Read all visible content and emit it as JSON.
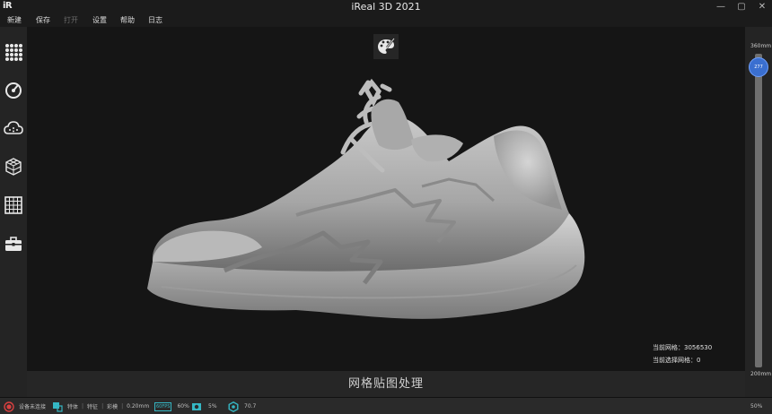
{
  "app": {
    "logo_text": "iR",
    "title": "iReal 3D 2021",
    "min_glyph": "—",
    "max_glyph": "▢",
    "close_glyph": "✕"
  },
  "menu": {
    "items": [
      {
        "label": "新建",
        "enabled": true
      },
      {
        "label": "保存",
        "enabled": true
      },
      {
        "label": "打开",
        "enabled": false
      },
      {
        "label": "设置",
        "enabled": true
      },
      {
        "label": "帮助",
        "enabled": true
      },
      {
        "label": "日志",
        "enabled": true
      }
    ]
  },
  "toolbar": {
    "tools": [
      "dots-grid-icon",
      "scan-dial-icon",
      "cloud-points-icon",
      "mesh-cube-icon",
      "grid-mesh-icon",
      "toolbox-icon"
    ]
  },
  "viewport": {
    "stats": {
      "current_mesh_label": "当前网格：",
      "current_mesh_value": "3056530",
      "selected_mesh_label": "当前选择网格：",
      "selected_mesh_value": "0"
    }
  },
  "slider": {
    "max_label": "360mm",
    "min_label": "200mm",
    "value": "277",
    "min": 200,
    "max": 360
  },
  "process_label": "网格贴图处理",
  "status": {
    "device": "设备未连接",
    "mode_a": "特体",
    "mode_b": "特征",
    "mode_c": "彩模",
    "resolution": "0.20mm",
    "fps_badge": "60FPS",
    "fps_value": "60%",
    "camera_value": "5%",
    "temp_value": "70.7",
    "zoom": "50%"
  },
  "colors": {
    "accent": "#3a6fd0",
    "status_red": "#d94040",
    "status_teal": "#35b7c4"
  }
}
